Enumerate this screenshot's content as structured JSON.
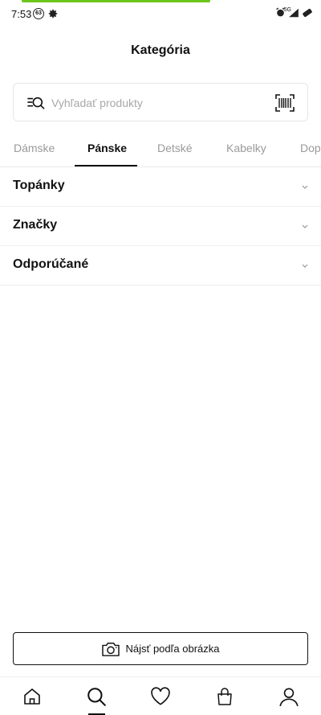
{
  "status_bar": {
    "time": "7:53",
    "notification_count": "63",
    "network": "5G",
    "accent_color": "#6cc61a"
  },
  "header": {
    "title": "Kategória"
  },
  "search": {
    "placeholder": "Vyhľadať produkty",
    "value": "",
    "icon": "search-list-icon",
    "scan_icon": "barcode-icon"
  },
  "tabs": [
    {
      "label": "Dámske",
      "active": false
    },
    {
      "label": "Pánske",
      "active": true
    },
    {
      "label": "Detské",
      "active": false
    },
    {
      "label": "Kabelky",
      "active": false
    },
    {
      "label": "Dop",
      "active": false
    }
  ],
  "categories": [
    {
      "label": "Topánky"
    },
    {
      "label": "Značky"
    },
    {
      "label": "Odporúčané"
    }
  ],
  "image_search": {
    "label": "Nájsť podľa obrázka",
    "icon": "camera-icon"
  },
  "bottom_nav": {
    "items": [
      {
        "icon": "home-icon",
        "active": false
      },
      {
        "icon": "search-icon",
        "active": true
      },
      {
        "icon": "heart-icon",
        "active": false
      },
      {
        "icon": "bag-icon",
        "active": false
      },
      {
        "icon": "user-icon",
        "active": false
      }
    ]
  }
}
